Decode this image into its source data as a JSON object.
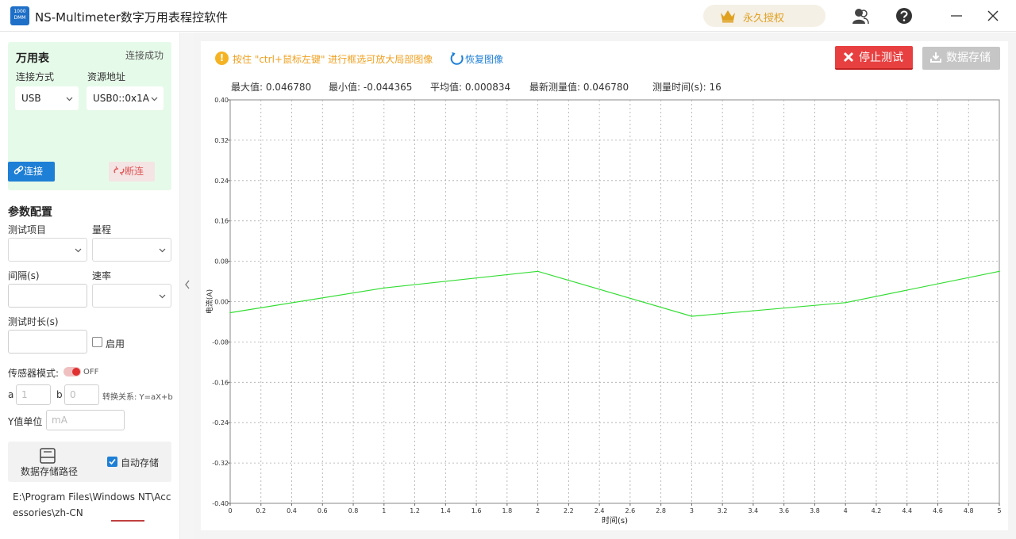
{
  "window": {
    "title": "NS-Multimeter数字万用表程控软件",
    "logo_text_top": "1000",
    "logo_text_bottom": "DMM",
    "license_label": "永久授权"
  },
  "connection": {
    "heading": "万用表",
    "status": "连接成功",
    "method_label": "连接方式",
    "method_value": "USB",
    "resource_label": "资源地址",
    "resource_value": "USB0::0x1A",
    "connect_label": "连接",
    "disconnect_label": "断连"
  },
  "params": {
    "heading": "参数配置",
    "test_item_label": "测试项目",
    "range_label": "量程",
    "interval_label": "间隔(s)",
    "rate_label": "速率",
    "duration_label": "测试时长(s)",
    "enable_label": "启用",
    "sensor_label": "传感器模式:",
    "sensor_state": "OFF",
    "a_label": "a",
    "a_placeholder": "1",
    "b_label": "b",
    "b_placeholder": "0",
    "transform_label": "转换关系:  Y=aX+b",
    "yunit_label": "Y值单位",
    "yunit_placeholder": "mA"
  },
  "storage": {
    "path_button_label": "数据存储路径",
    "auto_save_label": "自动存储",
    "path_text": "E:\\Program Files\\Windows NT\\Accessories\\zh-CN"
  },
  "toolbar": {
    "tip": "按住 \"ctrl+鼠标左键\" 进行框选可放大局部图像",
    "restore_label": "恢复图像",
    "stop_label": "停止测试",
    "save_label": "数据存储"
  },
  "stats": {
    "max": "最大值:  0.046780",
    "min": "最小值:  -0.044365",
    "avg": "平均值:  0.000834",
    "latest": "最新测量值:  0.046780",
    "time": "测量时间(s):  16"
  },
  "colors": {
    "accent": "#1e7fd6",
    "stop": "#e84040",
    "series": "#33dd33",
    "license": "#e0a020"
  },
  "chart_data": {
    "type": "line",
    "xlabel": "时间(s)",
    "ylabel": "电流(A)",
    "xlim": [
      0,
      5
    ],
    "ylim": [
      -0.4,
      0.4
    ],
    "x_ticks": [
      "0",
      "0.2",
      "0.4",
      "0.6",
      "0.8",
      "1",
      "1.2",
      "1.4",
      "1.6",
      "1.8",
      "2",
      "2.2",
      "2.4",
      "2.6",
      "2.8",
      "3",
      "3.2",
      "3.4",
      "3.6",
      "3.8",
      "4",
      "4.2",
      "4.4",
      "4.6",
      "4.8",
      "5"
    ],
    "y_ticks": [
      "0.40",
      "0.32",
      "0.24",
      "0.16",
      "0.08",
      "0.00",
      "-0.08",
      "-0.16",
      "-0.24",
      "-0.32",
      "-0.40"
    ],
    "grid": true,
    "series": [
      {
        "x": [
          0,
          1,
          2,
          3,
          4,
          5
        ],
        "y": [
          -0.022,
          0.027,
          0.06,
          -0.029,
          -0.002,
          0.06
        ]
      }
    ]
  }
}
